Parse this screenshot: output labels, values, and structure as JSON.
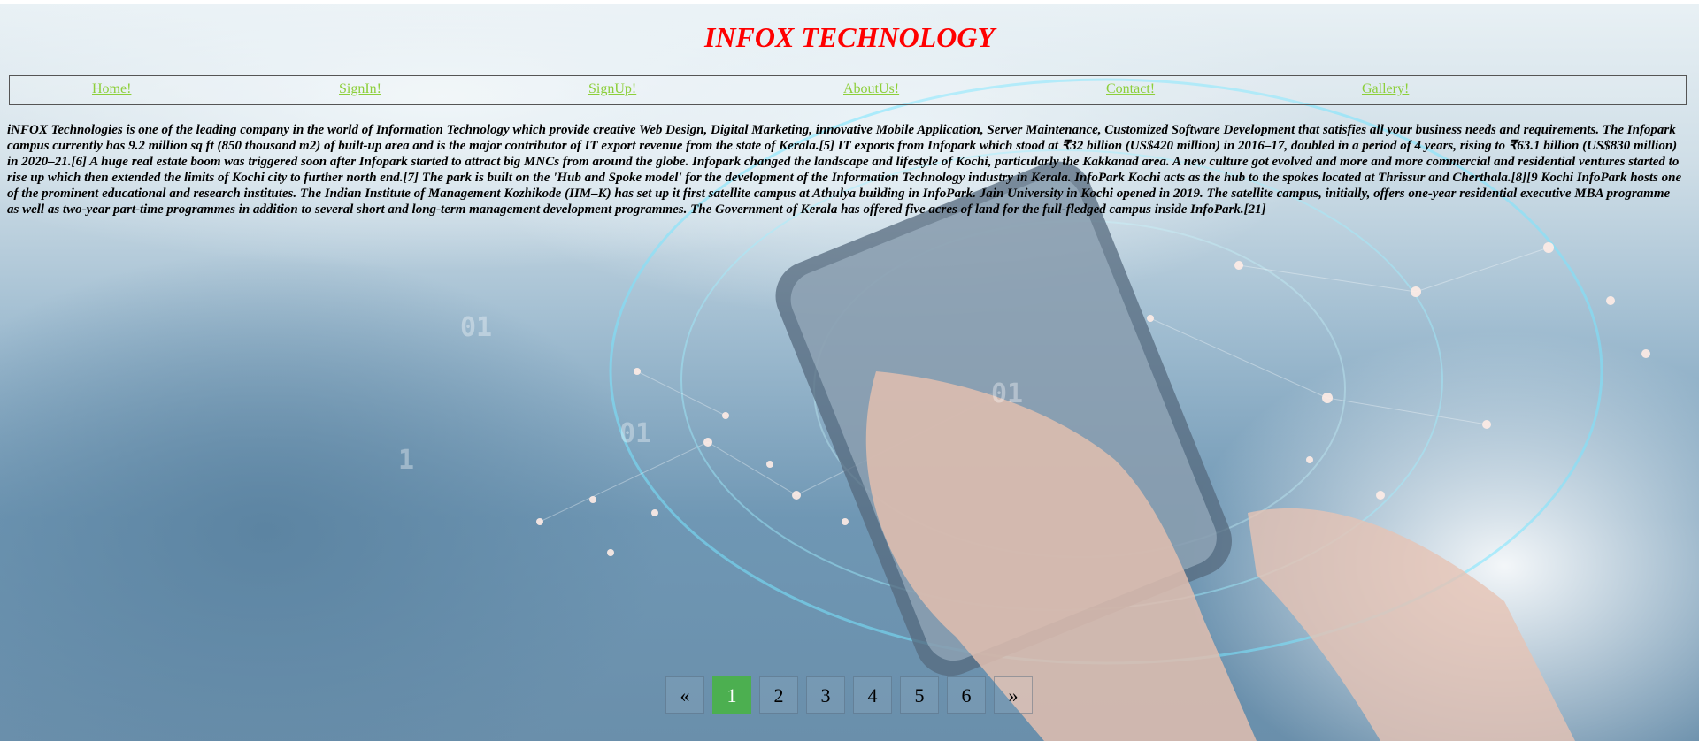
{
  "header": {
    "title": "INFOX TECHNOLOGY"
  },
  "nav": {
    "items": [
      {
        "label": "Home!"
      },
      {
        "label": "SignIn!"
      },
      {
        "label": "SignUp!"
      },
      {
        "label": "AboutUs!"
      },
      {
        "label": "Contact!"
      },
      {
        "label": "Gallery!"
      }
    ]
  },
  "content": {
    "paragraph": "iNFOX Technologies is one of the leading company in the world of Information Technology which provide creative Web Design, Digital Marketing, innovative Mobile Application, Server Maintenance, Customized Software Development that satisfies all your business needs and requirements. The Infopark campus currently has 9.2 million sq ft (850 thousand m2) of built-up area and is the major contributor of IT export revenue from the state of Kerala.[5] IT exports from Infopark which stood at ₹32 billion (US$420 million) in 2016–17, doubled in a period of 4 years, rising to ₹63.1 billion (US$830 million) in 2020–21.[6] A huge real estate boom was triggered soon after Infopark started to attract big MNCs from around the globe. Infopark changed the landscape and lifestyle of Kochi, particularly the Kakkanad area. A new culture got evolved and more and more commercial and residential ventures started to rise up which then extended the limits of Kochi city to further north end.[7] The park is built on the 'Hub and Spoke model' for the development of the Information Technology industry in Kerala. InfoPark Kochi acts as the hub to the spokes located at Thrissur and Cherthala.[8][9 Kochi InfoPark hosts one of the prominent educational and research institutes. The Indian Institute of Management Kozhikode (IIM–K) has set up it first satellite campus at Athulya building in InfoPark. Jain University in Kochi opened in 2019. The satellite campus, initially, offers one-year residential executive MBA programme as well as two-year part-time programmes in addition to several short and long-term management development programmes. The Government of Kerala has offered five acres of land for the full-fledged campus inside InfoPark.[21]"
  },
  "pagination": {
    "prev": "«",
    "pages": [
      "1",
      "2",
      "3",
      "4",
      "5",
      "6"
    ],
    "next": "»",
    "active_page": "1"
  },
  "background": {
    "image": "hand-holding-smartphone-network-illustration"
  },
  "colors": {
    "title": "#ff0000",
    "nav_link": "#8dcf3a",
    "active_page": "#4caf50"
  }
}
